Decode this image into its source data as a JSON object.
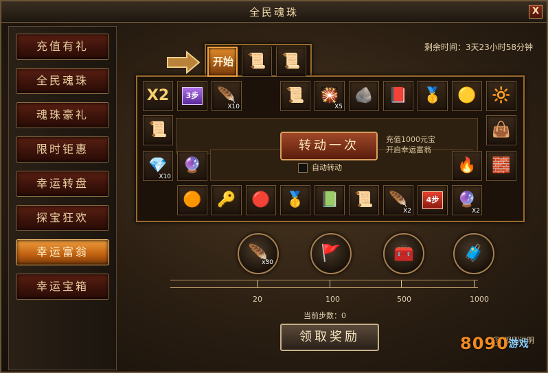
{
  "window": {
    "title": "全民魂珠",
    "close_label": "X"
  },
  "sidebar": {
    "items": [
      {
        "label": "充值有礼",
        "active": false
      },
      {
        "label": "全民魂珠",
        "active": false
      },
      {
        "label": "魂珠豪礼",
        "active": false
      },
      {
        "label": "限时钜惠",
        "active": false
      },
      {
        "label": "幸运转盘",
        "active": false
      },
      {
        "label": "探宝狂欢",
        "active": false
      },
      {
        "label": "幸运富翁",
        "active": true
      },
      {
        "label": "幸运宝箱",
        "active": false
      }
    ]
  },
  "timer": {
    "label": "剩余时间：3天23小时58分钟"
  },
  "board": {
    "start_label": "开始",
    "cells": [
      {
        "id": "top1",
        "icon": "scroll-icon",
        "glyph": "📜"
      },
      {
        "id": "top2",
        "icon": "scroll-gold-icon",
        "glyph": "📜"
      },
      {
        "id": "r1a",
        "multiplier": "X2"
      },
      {
        "id": "r1b",
        "arrow": "3步"
      },
      {
        "id": "r1c",
        "icon": "feather-icon",
        "glyph": "🪶",
        "qty": "X10"
      },
      {
        "id": "r1d",
        "icon": "scroll-blue-icon",
        "glyph": "📜"
      },
      {
        "id": "r1e",
        "icon": "firework-icon",
        "glyph": "🎇",
        "qty": "X5"
      },
      {
        "id": "r1f",
        "icon": "ore-icon",
        "glyph": "🪨"
      },
      {
        "id": "r1g",
        "icon": "red-scroll-icon",
        "glyph": "📕"
      },
      {
        "id": "r1h",
        "icon": "gold-ingot-icon",
        "glyph": "🥇"
      },
      {
        "id": "r1i",
        "icon": "gold-orb-icon",
        "glyph": "🟡"
      },
      {
        "id": "r1j",
        "icon": "gold-ball-icon",
        "glyph": "🔆"
      },
      {
        "id": "l1",
        "icon": "gold-scroll-icon",
        "glyph": "📜"
      },
      {
        "id": "r2",
        "icon": "treasure-bag-icon",
        "glyph": "👜"
      },
      {
        "id": "l2a",
        "icon": "green-gem-icon",
        "glyph": "💎",
        "qty": "X10"
      },
      {
        "id": "l2b",
        "icon": "pink-crystal-icon",
        "glyph": "🔮"
      },
      {
        "id": "r3a",
        "icon": "fire-orb-icon",
        "glyph": "🔥"
      },
      {
        "id": "r3b",
        "icon": "gold-bar-icon",
        "glyph": "🧱"
      },
      {
        "id": "b1",
        "icon": "bronze-ball-icon",
        "glyph": "🟠"
      },
      {
        "id": "b2",
        "icon": "gold-key-icon",
        "glyph": "🔑"
      },
      {
        "id": "b3",
        "icon": "red-seal-icon",
        "glyph": "🔴"
      },
      {
        "id": "b4",
        "icon": "gold-ingot-icon",
        "glyph": "🥇"
      },
      {
        "id": "b5",
        "icon": "green-book-icon",
        "glyph": "📗"
      },
      {
        "id": "b6",
        "icon": "purple-scroll-icon",
        "glyph": "📜"
      },
      {
        "id": "b7",
        "icon": "feather-icon",
        "glyph": "🪶",
        "qty": "X2"
      },
      {
        "id": "b8",
        "arrow": "4步"
      },
      {
        "id": "b9",
        "icon": "pink-crystal-icon",
        "glyph": "🔮",
        "qty": "X2"
      }
    ]
  },
  "spin": {
    "button_label": "转动一次",
    "hint_line1": "充值1000元宝",
    "hint_line2": "开启幸运富翁",
    "auto_label": "自动转动"
  },
  "rewards": [
    {
      "icon": "blue-feather-icon",
      "glyph": "🪶",
      "qty": "x30"
    },
    {
      "icon": "red-flag-icon",
      "glyph": "🚩"
    },
    {
      "icon": "treasure-chest-icon",
      "glyph": "🧰"
    },
    {
      "icon": "gold-chest-icon",
      "glyph": "🧳"
    }
  ],
  "progress": {
    "ticks": [
      "20",
      "100",
      "500",
      "1000"
    ],
    "current_steps": 0,
    "steps_label": "当前步数：0"
  },
  "claim": {
    "label": "领取奖励"
  },
  "rules": {
    "label": "规则说明"
  },
  "logo": {
    "brand": "8090",
    "suffix": "游戏"
  }
}
